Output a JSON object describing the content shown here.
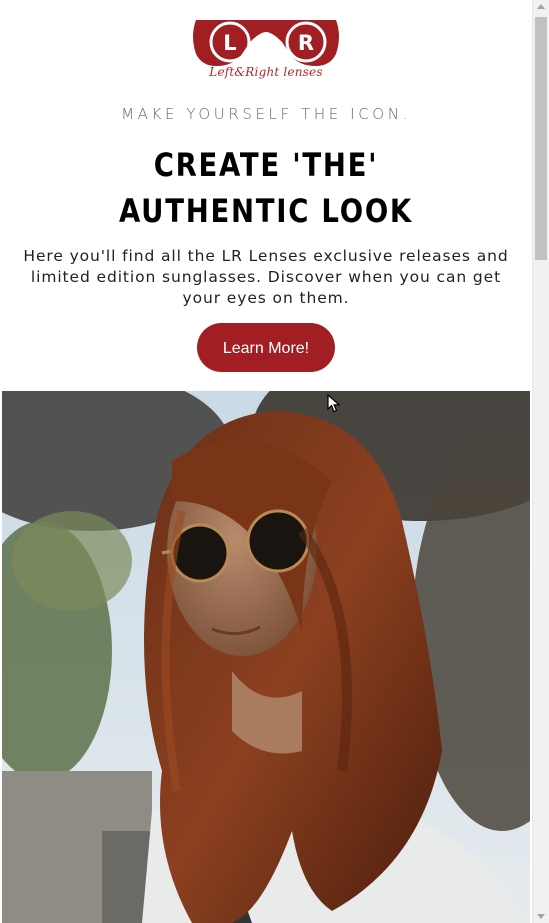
{
  "logo": {
    "left_letter": "L",
    "right_letter": "R",
    "caption": "Left&Right lenses",
    "brand_color": "#a11f23"
  },
  "hero_section": {
    "tagline": "MAKE YOURSELF THE ICON.",
    "headline_line1": "CREATE 'THE'",
    "headline_line2": "AUTHENTIC LOOK",
    "intro_line1": "Here you'll find all the LR Lenses exclusive releases and",
    "intro_line2": "limited edition sunglasses. Discover when you can get",
    "intro_line3": "your eyes on them.",
    "cta_label": "Learn More!"
  },
  "hero_image": {
    "subject": "woman-with-round-sunglasses-photo"
  },
  "colors": {
    "accent": "#a11f23",
    "text": "#000000",
    "muted": "#666666"
  }
}
